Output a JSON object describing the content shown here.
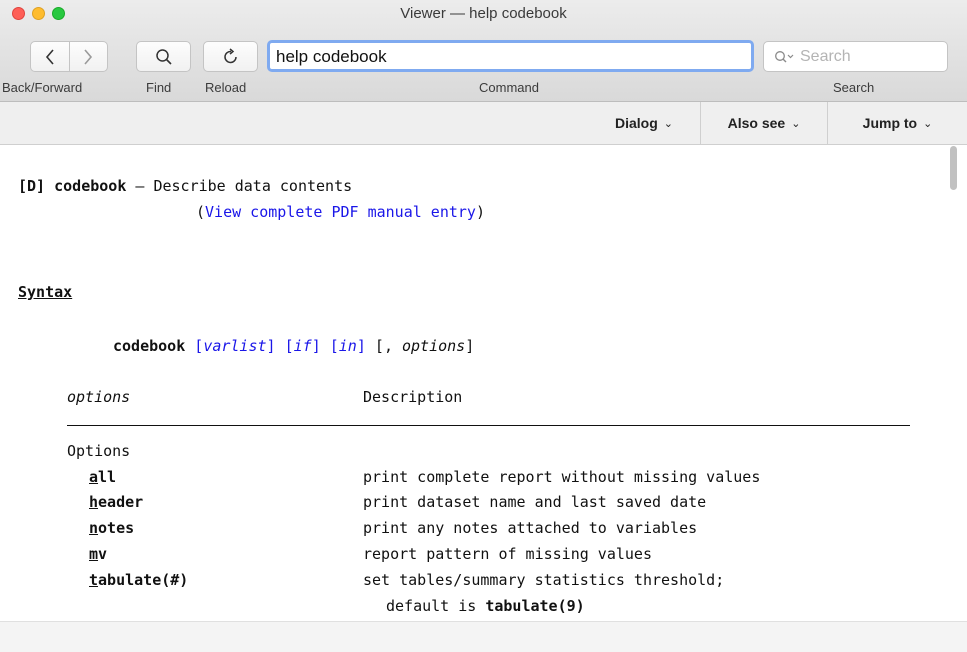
{
  "window": {
    "title": "Viewer — help codebook"
  },
  "toolbar": {
    "back_forward_label": "Back/Forward",
    "find_label": "Find",
    "reload_label": "Reload",
    "command_label": "Command",
    "search_label": "Search",
    "command_value": "help codebook",
    "search_placeholder": "Search"
  },
  "dialog_bar": {
    "dialog": "Dialog",
    "also_see": "Also see",
    "jump_to": "Jump to"
  },
  "help": {
    "heading_prefix": "[D] codebook",
    "heading_dash": " — ",
    "heading_desc": "Describe data contents",
    "pdf_paren_open": "(",
    "pdf_link": "View complete PDF manual entry",
    "pdf_paren_close": ")",
    "syntax_title": "Syntax",
    "syntax": {
      "cmd": "codebook",
      "varlist": "varlist",
      "if": "if",
      "in": "in",
      "comma": ", ",
      "options": "options"
    },
    "table_header_options": "options",
    "table_header_desc": "Description",
    "group_label": "Options",
    "rows": [
      {
        "abbr": "a",
        "rest": "ll",
        "desc": "print complete report without missing values"
      },
      {
        "abbr": "h",
        "rest": "eader",
        "desc": "print dataset name and last saved date"
      },
      {
        "abbr": "n",
        "rest": "otes",
        "desc": "print any notes attached to variables"
      },
      {
        "abbr": "m",
        "rest": "v",
        "desc": "report pattern of missing values"
      },
      {
        "abbr": "t",
        "rest": "abulate(#)",
        "desc": "set tables/summary statistics threshold;"
      }
    ],
    "default_prefix": "default is ",
    "default_value": "tabulate(9)"
  }
}
